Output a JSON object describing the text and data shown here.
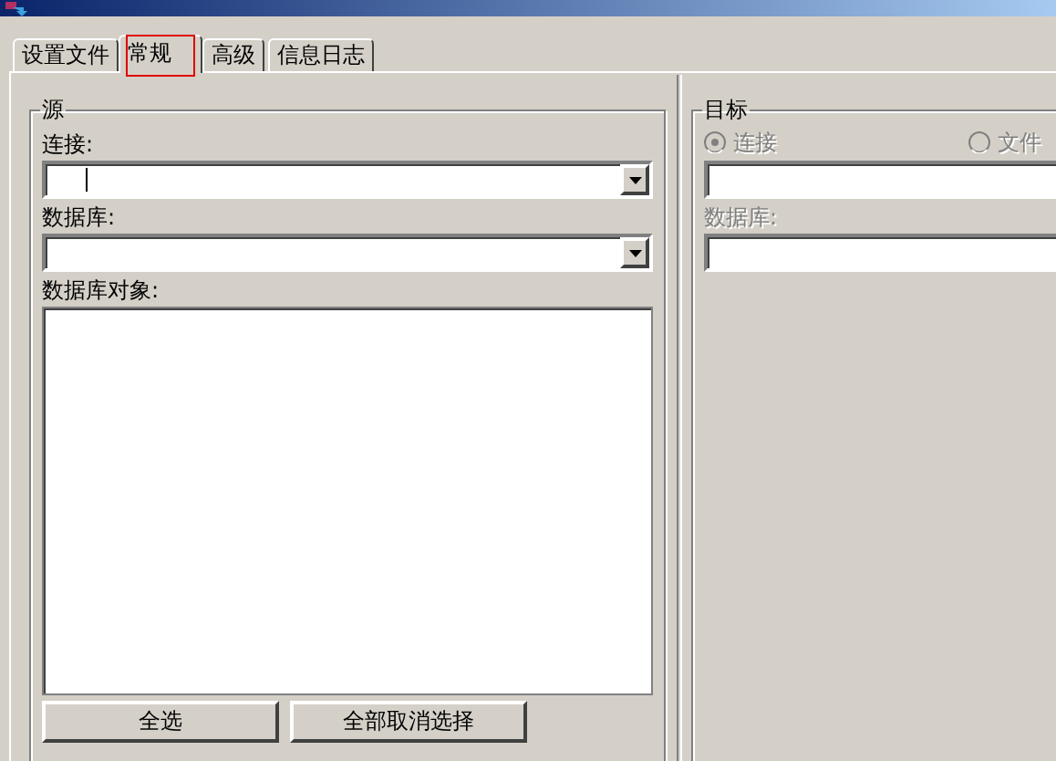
{
  "tabs": [
    {
      "label": "设置文件",
      "selected": false
    },
    {
      "label": "常规",
      "selected": true
    },
    {
      "label": "高级",
      "selected": false
    },
    {
      "label": "信息日志",
      "selected": false
    }
  ],
  "source": {
    "title": "源",
    "connection": {
      "label": "连接:",
      "focused": true
    },
    "database": {
      "label": "数据库:"
    },
    "objects": {
      "label": "数据库对象:"
    },
    "buttons": [
      {
        "label": "全选"
      },
      {
        "label": "全部取消选择"
      }
    ]
  },
  "target": {
    "title": "目标",
    "disabled": true,
    "modes": [
      {
        "label": "连接",
        "selected": true
      },
      {
        "label": "文件",
        "selected": false
      }
    ],
    "database": {
      "label": "数据库:"
    }
  }
}
